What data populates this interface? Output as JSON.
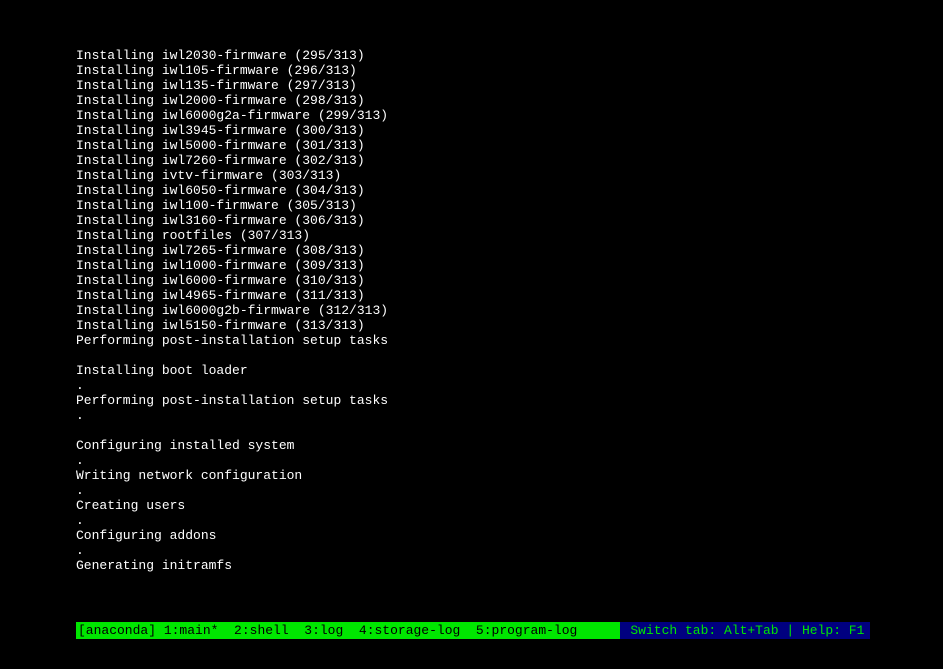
{
  "log_lines": [
    "Installing iwl2030-firmware (295/313)",
    "Installing iwl105-firmware (296/313)",
    "Installing iwl135-firmware (297/313)",
    "Installing iwl2000-firmware (298/313)",
    "Installing iwl6000g2a-firmware (299/313)",
    "Installing iwl3945-firmware (300/313)",
    "Installing iwl5000-firmware (301/313)",
    "Installing iwl7260-firmware (302/313)",
    "Installing ivtv-firmware (303/313)",
    "Installing iwl6050-firmware (304/313)",
    "Installing iwl100-firmware (305/313)",
    "Installing iwl3160-firmware (306/313)",
    "Installing rootfiles (307/313)",
    "Installing iwl7265-firmware (308/313)",
    "Installing iwl1000-firmware (309/313)",
    "Installing iwl6000-firmware (310/313)",
    "Installing iwl4965-firmware (311/313)",
    "Installing iwl6000g2b-firmware (312/313)",
    "Installing iwl5150-firmware (313/313)",
    "Performing post-installation setup tasks",
    "",
    "Installing boot loader",
    ".",
    "Performing post-installation setup tasks",
    ".",
    "",
    "Configuring installed system",
    ".",
    "Writing network configuration",
    ".",
    "Creating users",
    ".",
    "Configuring addons",
    ".",
    "Generating initramfs"
  ],
  "status_bar": {
    "prefix": "[anaconda]",
    "tabs": [
      {
        "id": "tab-main",
        "label": "1:main*"
      },
      {
        "id": "tab-shell",
        "label": "2:shell"
      },
      {
        "id": "tab-log",
        "label": "3:log"
      },
      {
        "id": "tab-storage-log",
        "label": "4:storage-log"
      },
      {
        "id": "tab-program-log",
        "label": "5:program-log"
      }
    ],
    "help_text": "Switch tab: Alt+Tab | Help: F1"
  }
}
